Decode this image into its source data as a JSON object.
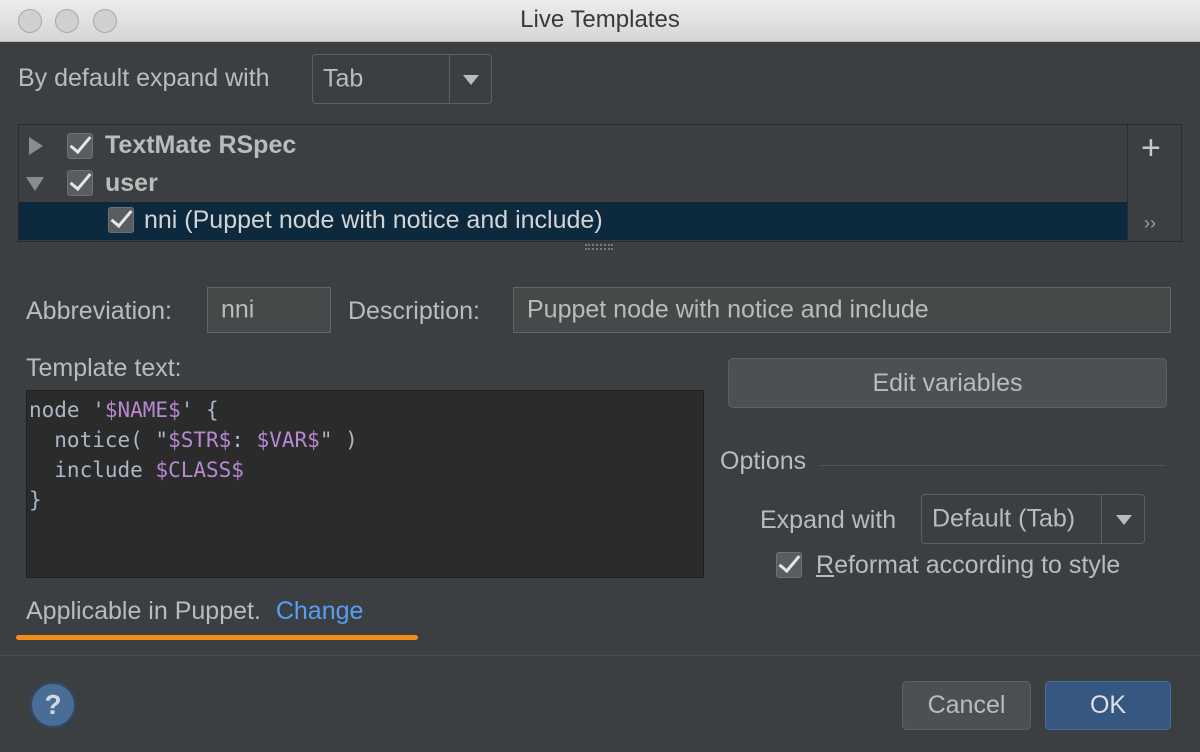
{
  "window": {
    "title": "Live Templates"
  },
  "expand": {
    "label": "By default expand with",
    "value": "Tab"
  },
  "tree": {
    "groups": [
      {
        "label": "TextMate RSpec",
        "checked": true,
        "expanded": false
      },
      {
        "label": "user",
        "checked": true,
        "expanded": true
      }
    ],
    "selected_item": {
      "label": "nni (Puppet node with notice and include)",
      "checked": true
    },
    "add_icon": "+",
    "more_icon": "››"
  },
  "form": {
    "abbreviation_label": "Abbreviation:",
    "abbreviation_value": "nni",
    "description_label": "Description:",
    "description_value": "Puppet node with notice and include",
    "template_text_label": "Template text:"
  },
  "template": {
    "line1_a": "node '",
    "line1_var": "$NAME$",
    "line1_b": "' {",
    "line2_a": "  notice( \"",
    "line2_var1": "$STR$",
    "line2_mid": ": ",
    "line2_var2": "$VAR$",
    "line2_b": "\" )",
    "line3_a": "  include ",
    "line3_var": "$CLASS$",
    "line4": "}"
  },
  "options": {
    "edit_variables": "Edit variables",
    "title": "Options",
    "expand_with_label": "Expand with",
    "expand_with_value": "Default (Tab)",
    "reformat_label_underlined": "R",
    "reformat_label_rest": "eformat according to style",
    "reformat_checked": true
  },
  "applicable": {
    "text": "Applicable in Puppet.",
    "link": "Change",
    "highlight_color": "#f0901a"
  },
  "footer": {
    "help": "?",
    "cancel": "Cancel",
    "ok": "OK"
  }
}
